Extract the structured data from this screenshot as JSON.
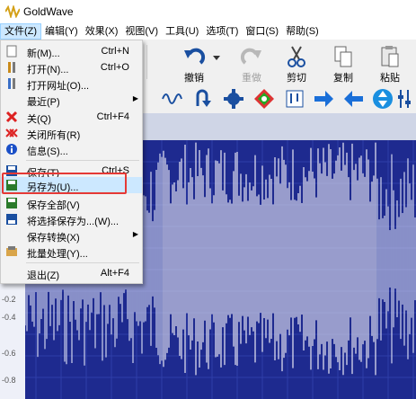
{
  "window": {
    "title": "GoldWave"
  },
  "menubar": [
    {
      "label": "文件(Z)",
      "active": true
    },
    {
      "label": "编辑(Y)"
    },
    {
      "label": "效果(X)"
    },
    {
      "label": "视图(V)"
    },
    {
      "label": "工具(U)"
    },
    {
      "label": "选项(T)"
    },
    {
      "label": "窗口(S)"
    },
    {
      "label": "帮助(S)"
    }
  ],
  "toolbar": {
    "undo": "撤销",
    "redo": "重做",
    "cut": "剪切",
    "copy": "复制",
    "paste": "粘贴"
  },
  "file_menu": [
    {
      "label": "新(M)...",
      "shortcut": "Ctrl+N",
      "icon": "new-file-icon"
    },
    {
      "label": "打开(N)...",
      "shortcut": "Ctrl+O",
      "icon": "open-icon"
    },
    {
      "label": "打开网址(O)...",
      "shortcut": "",
      "icon": "open-url-icon"
    },
    {
      "label": "最近(P)",
      "shortcut": "",
      "icon": "",
      "submenu": true
    },
    {
      "label": "关(Q)",
      "shortcut": "Ctrl+F4",
      "icon": "close-icon"
    },
    {
      "label": "关闭所有(R)",
      "shortcut": "",
      "icon": "close-all-icon"
    },
    {
      "label": "信息(S)...",
      "shortcut": "",
      "icon": "info-icon"
    },
    {
      "label": "保存(T)",
      "shortcut": "Ctrl+S",
      "icon": "save-icon"
    },
    {
      "label": "另存为(U)...",
      "shortcut": "",
      "icon": "save-as-icon",
      "highlighted": true
    },
    {
      "label": "保存全部(V)",
      "shortcut": "",
      "icon": "save-all-icon"
    },
    {
      "label": "将选择保存为...(W)...",
      "shortcut": "",
      "icon": "save-selection-icon"
    },
    {
      "label": "保存转换(X)",
      "shortcut": "",
      "icon": "",
      "submenu": true
    },
    {
      "label": "批量处理(Y)...",
      "shortcut": "",
      "icon": "batch-icon"
    },
    {
      "label": "退出(Z)",
      "shortcut": "Alt+F4",
      "icon": ""
    }
  ],
  "waveform": {
    "axis_labels": [
      "-0.2",
      "-0.4",
      "-0.6",
      "-0.8"
    ]
  },
  "colors": {
    "wave_bg": "#1e2a8f",
    "highlight": "#cce8ff",
    "callout": "#e53935"
  }
}
